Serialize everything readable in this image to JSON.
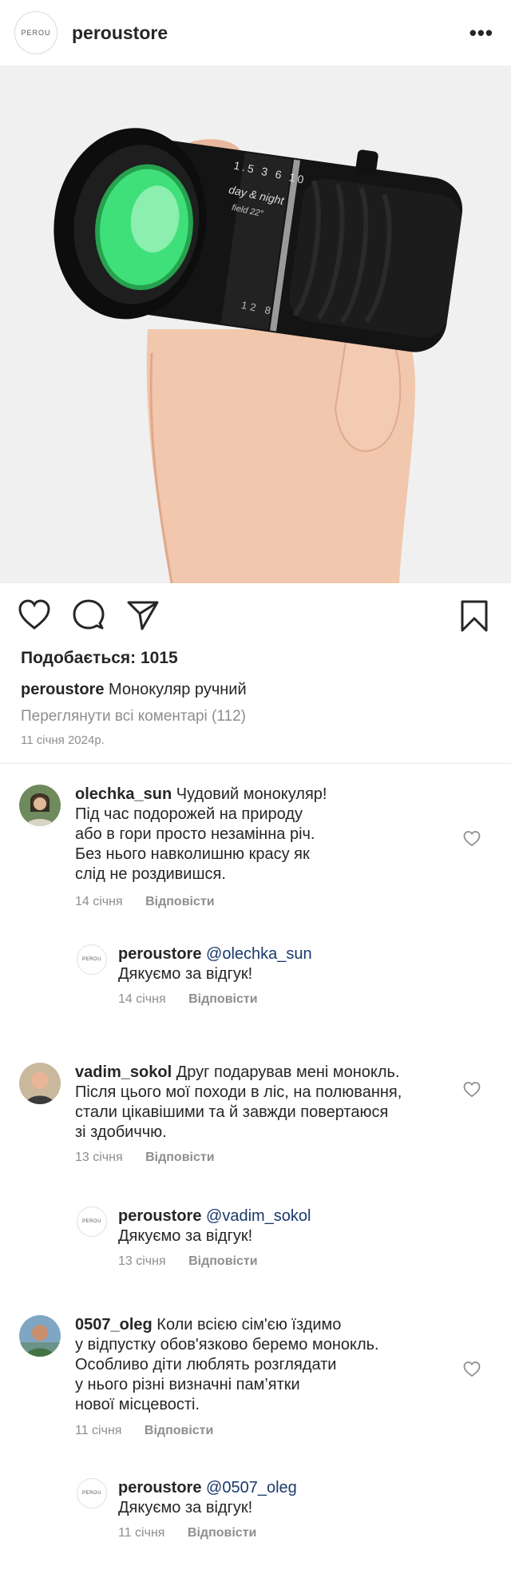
{
  "header": {
    "logo_text": "PEROU",
    "account": "peroustore",
    "more_label": "•••"
  },
  "post": {
    "image_text": {
      "scale": "1.5 3 6 10",
      "day_night": "day & night",
      "field": "field 22°",
      "bottom_scale": "12 8"
    },
    "likes": "Подобається: 1015",
    "caption_user": "peroustore",
    "caption_text": "Монокуляр ручний",
    "view_all": "Переглянути всі коментарі (112)",
    "date": "11 січня 2024р."
  },
  "comments": [
    {
      "user": "olechka_sun",
      "lines": [
        "Чудовий монокуляр!",
        "Під час подорожей на природу",
        "або в гори просто незамінна річ.",
        "Без нього навколишню красу як",
        "слід не роздивишся."
      ],
      "first_line": "Чудовий монокуляр!",
      "line2": "Під час подорожей на природу",
      "line3": "або в гори просто незамінна річ.",
      "line4": "Без нього навколишню красу як",
      "line5": "слід не роздивишся.",
      "date": "14 січня",
      "reply_label": "Відповісти",
      "reply": {
        "user": "peroustore",
        "mention": "@olechka_sun",
        "text": "Дякуємо за відгук!",
        "date": "14 січня",
        "reply_label": "Відповісти"
      }
    },
    {
      "user": "vadim_sokol",
      "first_line": "Друг подарував мені монокль.",
      "line2": "Після цього мої походи в ліс, на полювання,",
      "line3": "стали цікавішими та й завжди повертаюся",
      "line4": "зі здобиччю.",
      "date": "13 січня",
      "reply_label": "Відповісти",
      "reply": {
        "user": "peroustore",
        "mention": "@vadim_sokol",
        "text": "Дякуємо за відгук!",
        "date": "13 січня",
        "reply_label": "Відповісти"
      }
    },
    {
      "user": "0507_oleg",
      "first_line": "Коли всією сім'єю їздимо",
      "line2": "у відпустку обов'язково беремо монокль.",
      "line3": "Особливо діти люблять розглядати",
      "line4": "у нього різні визначні пам’ятки",
      "line5": "нової місцевості.",
      "date": "11 січня",
      "reply_label": "Відповісти",
      "reply": {
        "user": "peroustore",
        "mention": "@0507_oleg",
        "text": "Дякуємо за відгук!",
        "date": "11 січня",
        "reply_label": "Відповісти"
      }
    }
  ],
  "colors": {
    "accent_mention": "#1a3a6b",
    "muted": "#8e8e8e",
    "lens": "#3fe07a"
  }
}
